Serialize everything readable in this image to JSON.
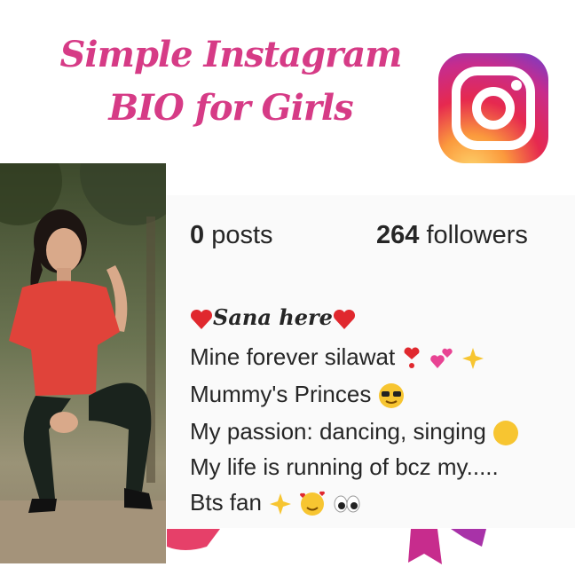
{
  "header": {
    "title_line1": "Simple Instagram",
    "title_line2": "BIO for Girls"
  },
  "logo": {
    "icon": "instagram-logo-icon"
  },
  "profile": {
    "posts_count": "0",
    "posts_label": " posts",
    "followers_count": "264",
    "followers_label": " followers"
  },
  "bio": {
    "name": "Sana here",
    "line1": "Mine forever silawat",
    "line2": " Mummy's Princes",
    "line3": "My passion: dancing, singing",
    "line4": "My life is running of bcz my.....",
    "line5": "Bts fan"
  },
  "colors": {
    "title_pink": "#d63b86",
    "text_dark": "#262626",
    "heart_red": "#e0282e"
  }
}
